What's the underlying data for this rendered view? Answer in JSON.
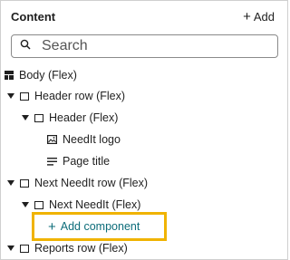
{
  "panel": {
    "title": "Content",
    "add_label": "Add"
  },
  "search": {
    "placeholder": "Search"
  },
  "tree": {
    "body": "Body (Flex)",
    "header_row": "Header row (Flex)",
    "header": "Header (Flex)",
    "needit_logo": "NeedIt logo",
    "page_title": "Page title",
    "next_needit_row": "Next NeedIt row (Flex)",
    "next_needit": "Next NeedIt (Flex)",
    "add_component": "Add component",
    "reports_row": "Reports row (Flex)"
  },
  "colors": {
    "highlight": "#f0b300",
    "link": "#0d6d7a"
  }
}
